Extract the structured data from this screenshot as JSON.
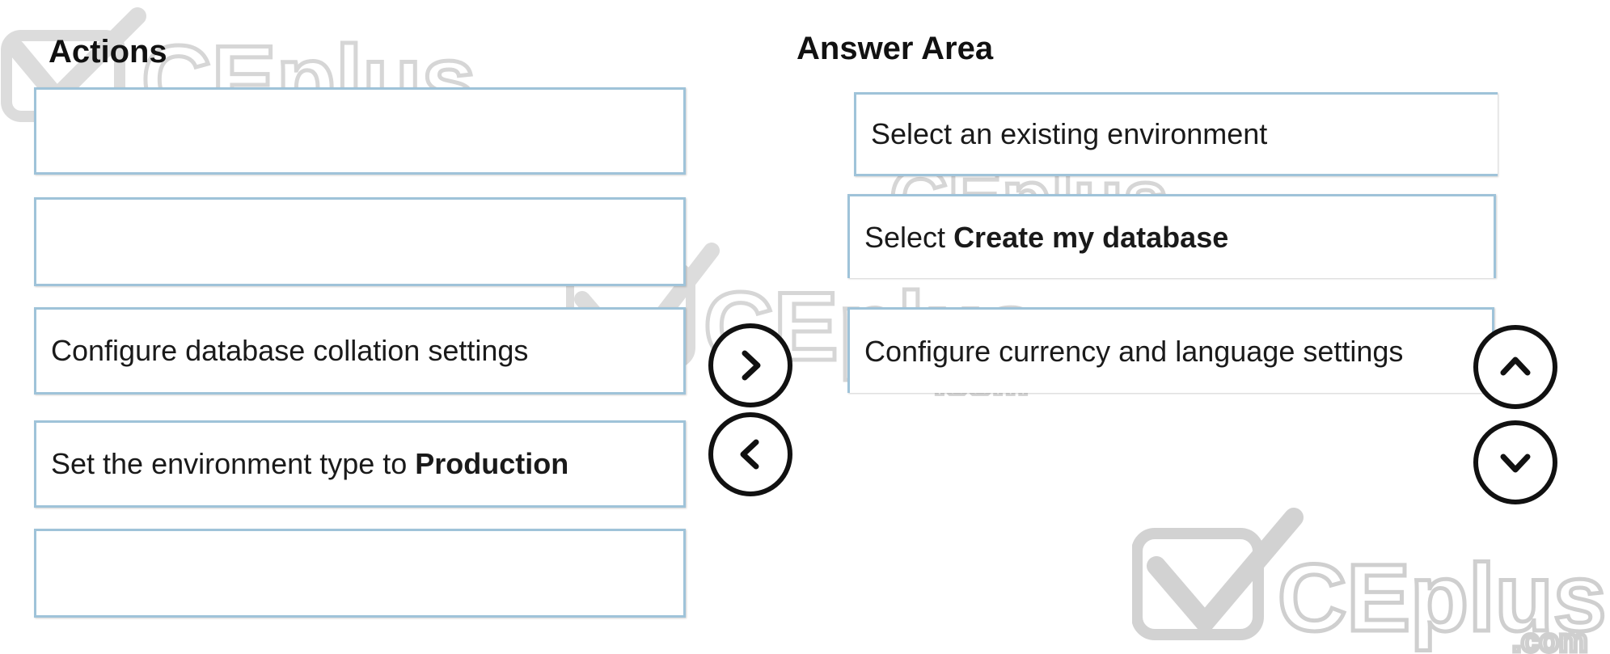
{
  "actions": {
    "heading": "Actions",
    "items": [
      {
        "text": "",
        "bold": ""
      },
      {
        "text": "",
        "bold": ""
      },
      {
        "text": "Configure database collation settings",
        "bold": ""
      },
      {
        "text": "Set the environment type to ",
        "bold": "Production"
      },
      {
        "text": "",
        "bold": ""
      }
    ]
  },
  "answer_area": {
    "heading": "Answer Area",
    "items": [
      {
        "text": "Select an existing environment",
        "bold": ""
      },
      {
        "text": "Select ",
        "bold": "Create my database"
      },
      {
        "text": "Configure currency and language settings",
        "bold": ""
      }
    ]
  },
  "controls": {
    "move_right_icon": "chevron-right-icon",
    "move_left_icon": "chevron-left-icon",
    "move_up_icon": "chevron-up-icon",
    "move_down_icon": "chevron-down-icon"
  },
  "watermark": {
    "brand": "CEplus",
    "suffix": ".com"
  },
  "colors": {
    "box_border": "#9fc3d9",
    "watermark": "#d6d6d6",
    "button_stroke": "#111111"
  }
}
